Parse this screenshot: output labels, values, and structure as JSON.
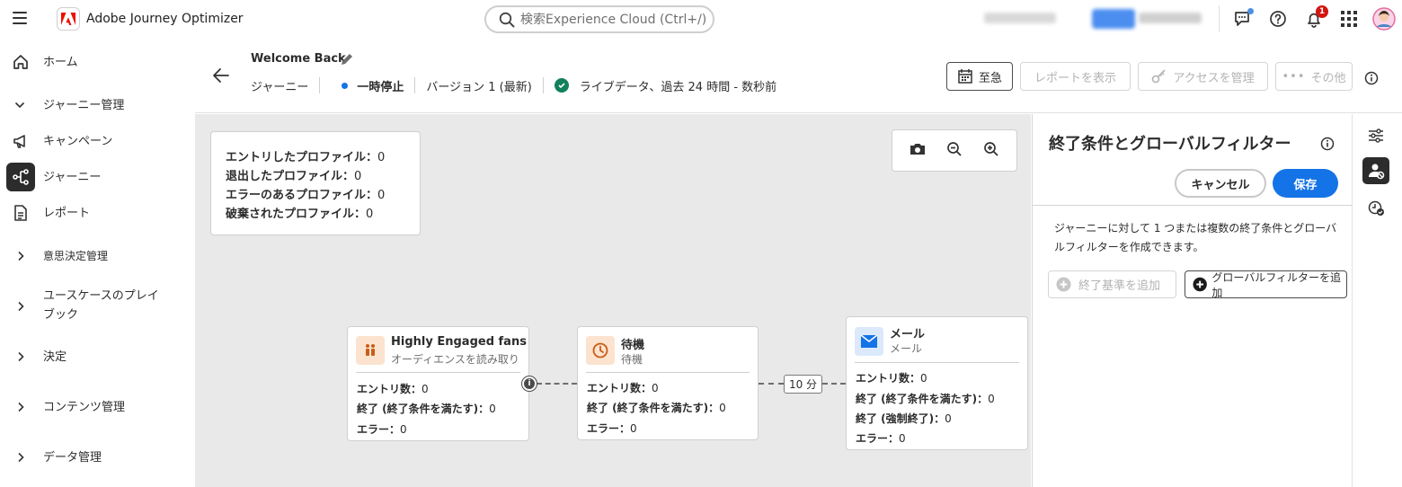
{
  "app": {
    "name": "Adobe Journey Optimizer",
    "search_placeholder": "検索Experience Cloud (Ctrl+/)",
    "notification_count": "1"
  },
  "nav": {
    "home": "ホーム",
    "journey_mgmt": "ジャーニー管理",
    "campaigns": "キャンペーン",
    "journeys": "ジャーニー",
    "reports": "レポート",
    "decision_mgmt": "意思決定管理",
    "usecase_line1": "ユースケースのプレイ",
    "usecase_line2": "ブック",
    "decisions": "決定",
    "content_mgmt": "コンテンツ管理",
    "data_mgmt": "データ管理"
  },
  "header": {
    "title": "Welcome Back",
    "breadcrumb": "ジャーニー",
    "status": "一時停止",
    "version": "バージョン 1 (最新)",
    "live": "ライブデータ、過去 24 時間 - 数秒前",
    "urgent_label": "至急",
    "view_report_label": "レポートを表示",
    "manage_access_label": "アクセスを管理",
    "more_label": "その他"
  },
  "stats": {
    "entered_label": "エントリしたプロファイル：",
    "entered_value": "0",
    "exited_label": "退出したプロファイル：",
    "exited_value": "0",
    "error_label": "エラーのあるプロファイル：",
    "error_value": "0",
    "discarded_label": "破棄されたプロファイル：",
    "discarded_value": "0"
  },
  "nodes": {
    "audience": {
      "title": "Highly Engaged fans",
      "subtitle": "オーディエンスを読み取り",
      "entries_label": "エントリ数：",
      "entries_value": "0",
      "exit_label": "終了 (終了条件を満たす)：",
      "exit_value": "0",
      "error_label": "エラー：",
      "error_value": "0"
    },
    "wait": {
      "title": "待機",
      "subtitle": "待機",
      "entries_label": "エントリ数：",
      "entries_value": "0",
      "exit_label": "終了 (終了条件を満たす)：",
      "exit_value": "0",
      "error_label": "エラー：",
      "error_value": "0"
    },
    "wait_duration": "10 分",
    "email": {
      "title": "メール",
      "subtitle": "メール",
      "entries_label": "エントリ数：",
      "entries_value": "0",
      "exit_label": "終了 (終了条件を満たす)：",
      "exit_value": "0",
      "forced_label": "終了 (強制終了)：",
      "forced_value": "0",
      "error_label": "エラー：",
      "error_value": "0"
    }
  },
  "panel": {
    "title": "終了条件とグローバルフィルター",
    "cancel_label": "キャンセル",
    "save_label": "保存",
    "desc_line1": "ジャーニーに対して 1 つまたは複数の終了条件とグローバ",
    "desc_line2": "ルフィルターを作成できます。",
    "add_exit_label": "終了基準を追加",
    "add_filter_label": "グローバルフィルターを追加"
  },
  "colors": {
    "accent": "#1473e6",
    "success": "#12805c",
    "notification": "#d31510",
    "canvas_bg": "#e9e9e9"
  }
}
